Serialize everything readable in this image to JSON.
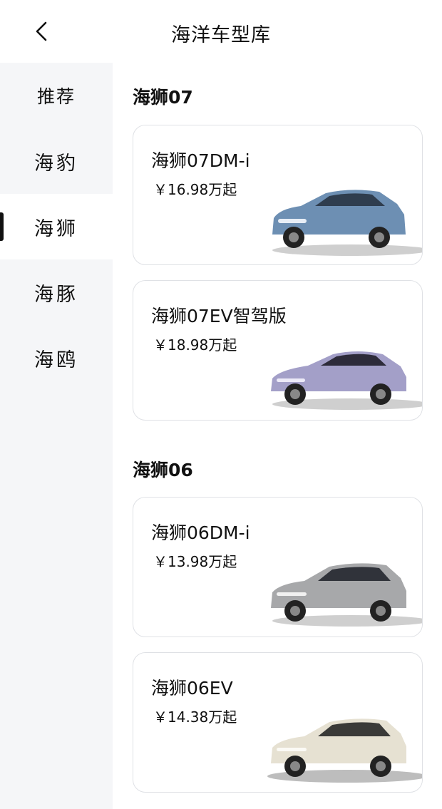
{
  "header": {
    "title": "海洋车型库",
    "back_icon": "chevron-left-icon"
  },
  "sidebar": {
    "items": [
      {
        "label": "推荐"
      },
      {
        "label": "海豹"
      },
      {
        "label": "海狮",
        "active": true
      },
      {
        "label": "海豚"
      },
      {
        "label": "海鸥"
      }
    ]
  },
  "sections": [
    {
      "title": "海狮07",
      "cards": [
        {
          "name": "海狮07DM-i",
          "price": "￥16.98万起",
          "car_color": "#6d8fb3"
        },
        {
          "name": "海狮07EV智驾版",
          "price": "￥18.98万起",
          "car_color": "#a39fc8"
        }
      ]
    },
    {
      "title": "海狮06",
      "cards": [
        {
          "name": "海狮06DM-i",
          "price": "￥13.98万起",
          "car_color": "#a7a8aa"
        },
        {
          "name": "海狮06EV",
          "price": "￥14.38万起",
          "car_color": "#e6e1d2"
        }
      ]
    }
  ]
}
